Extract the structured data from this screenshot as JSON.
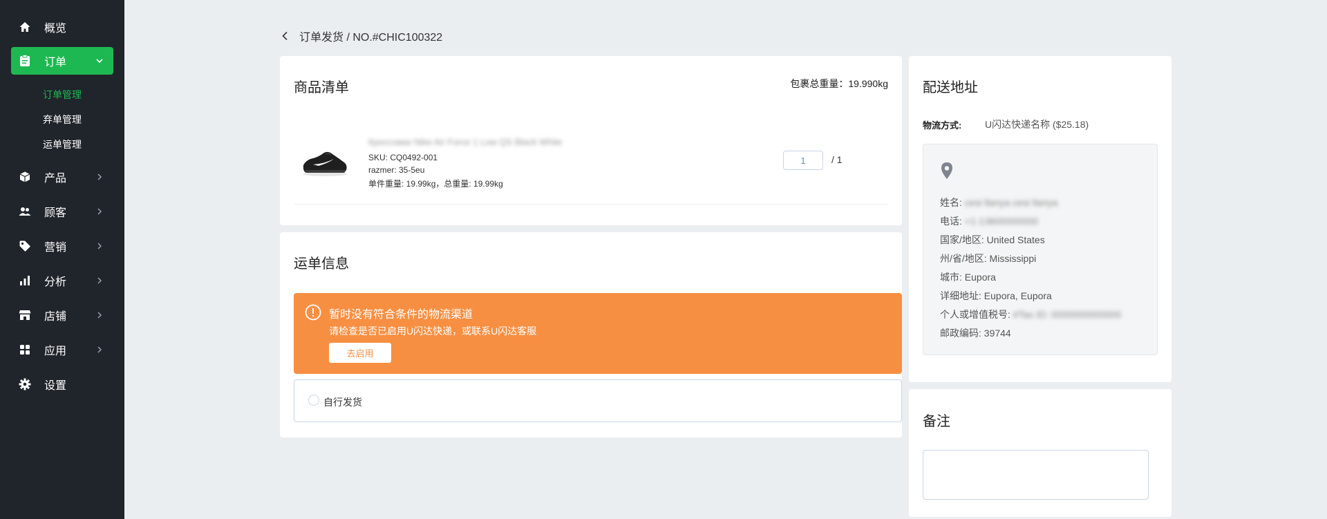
{
  "sidebar": {
    "items": [
      {
        "label": "概览",
        "icon": "home-icon"
      },
      {
        "label": "订单",
        "icon": "clipboard-icon"
      },
      {
        "label": "产品",
        "icon": "box-icon"
      },
      {
        "label": "顾客",
        "icon": "users-icon"
      },
      {
        "label": "营销",
        "icon": "tag-icon"
      },
      {
        "label": "分析",
        "icon": "bar-chart-icon"
      },
      {
        "label": "店铺",
        "icon": "store-icon"
      },
      {
        "label": "应用",
        "icon": "apps-icon"
      },
      {
        "label": "设置",
        "icon": "gear-icon"
      }
    ],
    "sub_items": [
      "订单管理",
      "弃单管理",
      "运单管理"
    ],
    "accent_color": "#1eb852",
    "background_color": "#20242b"
  },
  "header": {
    "breadcrumb": "订单发货 / NO.#CHIC100322"
  },
  "products": {
    "title": "商品清单",
    "total_weight": "包裹总重量：19.990kg",
    "item": {
      "name": "Кроссовки Nike Air Force 1 Low QS Black White",
      "sku": "SKU: CQ0492-001",
      "size": "razmer: 35-5eu",
      "weight": "单件重量: 19.99kg，总重量: 19.99kg",
      "qty": "1",
      "qty_total": "/  1"
    }
  },
  "waybill": {
    "title": "运单信息",
    "alert": {
      "title": "暂时没有符合条件的物流渠道",
      "desc": "请检查是否已启用U闪达快递，或联系U闪达客服",
      "button": "去启用",
      "color": "#f78f42"
    },
    "self_ship_label": "自行发货"
  },
  "shipping": {
    "title": "配送地址",
    "method_label": "物流方式:",
    "method_value": "U闪达快递名称 ($25.18)",
    "address": {
      "name_label": "姓名: ",
      "name_value": "cesi llanya cesi llanya",
      "phone_label": "电话: ",
      "phone_value": "+1-13600000000",
      "country": "国家/地区: United States",
      "state": "州/省/地区: Mississippi",
      "city": "城市: Eupora",
      "detail": "详细地址: Eupora, Eupora",
      "tax_label": "个人或增值税号: ",
      "tax_value": "#Tax ID: 0000000000000",
      "zip": "邮政编码: 39744"
    }
  },
  "remark": {
    "title": "备注",
    "value": ""
  }
}
